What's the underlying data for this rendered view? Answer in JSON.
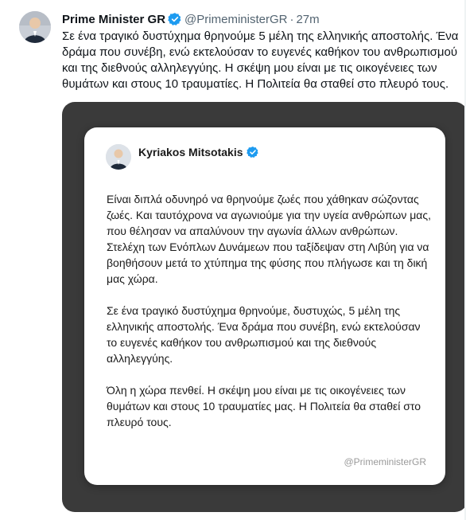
{
  "tweet": {
    "author_name": "Prime Minister GR",
    "handle": "@PrimeministerGR",
    "separator": "·",
    "time": "27m",
    "text": "Σε ένα τραγικό δυστύχημα θρηνούμε 5 μέλη της ελληνικής αποστολής. Ένα δράμα που συνέβη, ενώ εκτελούσαν το ευγενές καθήκον του ανθρωπισμού και της διεθνούς αλληλεγγύης. Η σκέψη μου είναι με τις οικογένειες των θυμάτων και στους 10 τραυματίες. Η Πολιτεία θα σταθεί στο πλευρό τους."
  },
  "card": {
    "name": "Kyriakos Mitsotakis",
    "paragraphs": [
      "Είναι διπλά οδυνηρό να θρηνούμε ζωές που χάθηκαν σώζοντας ζωές. Και ταυτόχρονα να αγωνιούμε για την υγεία ανθρώπων μας, που θέλησαν να απαλύνουν την αγωνία άλλων ανθρώπων. Στελέχη των Ενόπλων Δυνάμεων που ταξίδεψαν στη Λιβύη για να βοηθήσουν μετά το χτύπημα της φύσης που πλήγωσε και τη δική μας χώρα.",
      "Σε ένα τραγικό δυστύχημα θρηνούμε, δυστυχώς, 5 μέλη της ελληνικής αποστολής. Ένα δράμα που συνέβη, ενώ εκτελούσαν το ευγενές καθήκον του ανθρωπισμού και της διεθνούς αλληλεγγύης.",
      "Όλη η χώρα πενθεί. Η σκέψη μου είναι με τις οικογένειες των θυμάτων και στους 10 τραυματίες μας. Η Πολιτεία θα σταθεί στο πλευρό τους."
    ],
    "footer_handle": "@PrimeministerGR"
  },
  "icons": {
    "verified": "verified-badge-icon",
    "avatar": "avatar-portrait"
  },
  "colors": {
    "verified_blue": "#1d9bf0",
    "media_background": "#3a3a3a",
    "secondary_text": "#536471"
  }
}
